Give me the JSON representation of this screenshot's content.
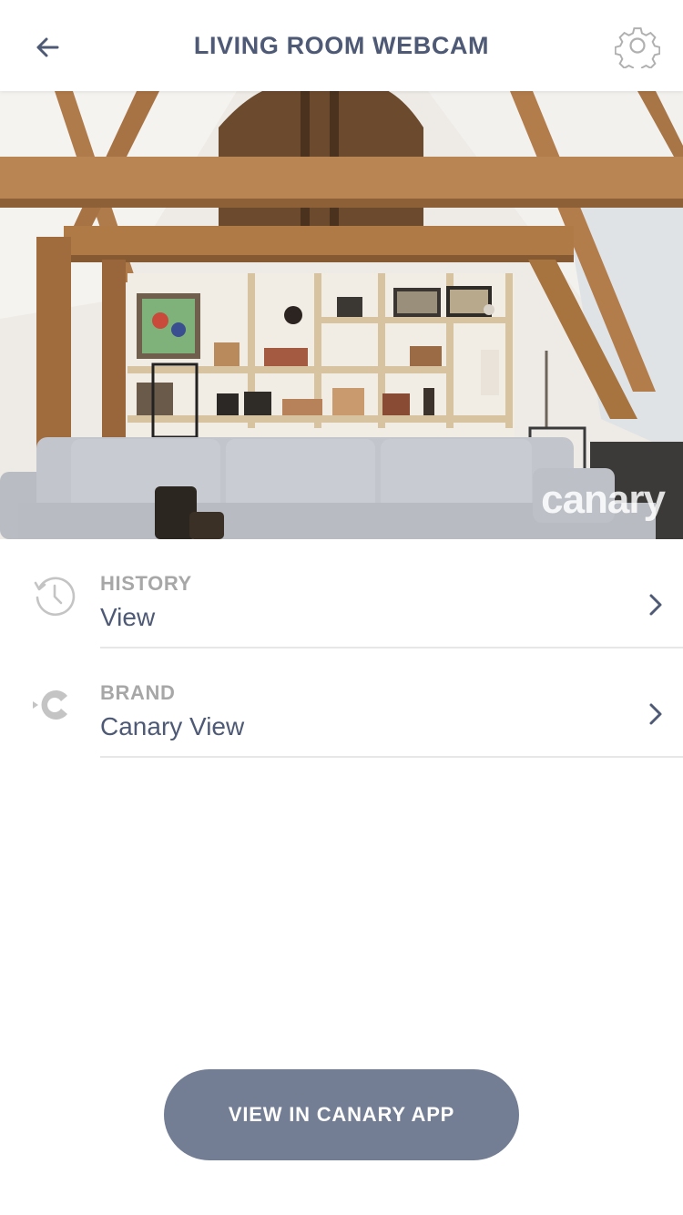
{
  "header": {
    "title": "LIVING ROOM WEBCAM",
    "back_icon": "arrow-left-icon",
    "settings_icon": "gear-icon"
  },
  "feed": {
    "watermark": "canary"
  },
  "list": [
    {
      "label": "HISTORY",
      "value": "View",
      "icon": "history-icon"
    },
    {
      "label": "BRAND",
      "value": "Canary View",
      "icon": "canary-logo-icon"
    }
  ],
  "cta": {
    "label": "VIEW IN CANARY APP"
  },
  "colors": {
    "primary_text": "#4e5a75",
    "muted_label": "#a7a7a7",
    "button_bg": "#737e94",
    "divider": "#e7e7e7"
  }
}
